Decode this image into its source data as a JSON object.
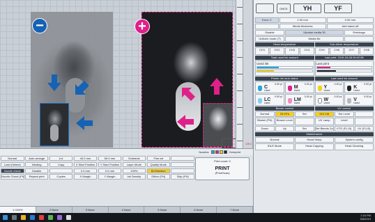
{
  "workarea": {
    "badge_minus": "−",
    "badge_plus": "+",
    "ruler_labels": [
      "",
      "",
      "",
      "",
      "",
      "",
      "",
      "",
      ""
    ],
    "red_tag": "125.0"
  },
  "toolbar_top": {
    "label_a": "Nozzles",
    "label_b": "Overprint"
  },
  "params": {
    "cells": [
      "Normal",
      "Auto arrange",
      "1x1",
      "40.0 mm",
      "50.0 mm",
      "Schedule",
      "Fine art",
      "",
      "Load (Select)",
      "Nesting",
      "Copy",
      "X Start Position",
      "Y Start Position",
      "Layer Mode",
      "Quality Mode",
      "",
      "Nozzle check",
      "Disable",
      "",
      "0.0 mm",
      "0.0 mm",
      "100%",
      "Bi-Direction",
      "",
      "Nozzle Check (FN)",
      "Repeat print",
      "Copies",
      "X Margin",
      "Y Margin",
      "Ink Density",
      "Dither (FN)",
      "Skip (FN)"
    ],
    "print_count_label": "Print count: 0",
    "print_label": "PRINT",
    "print_sub": "(Print/Scan)",
    "colors": {
      "accent": "#f3cf2a",
      "minus": "#1662b4",
      "plus": "#e0208a"
    }
  },
  "tabs": [
    "1 CMYK",
    "2 None",
    "3 None",
    "4 None",
    "5 None",
    "6 None",
    "7 None"
  ],
  "right_panel": {
    "header": {
      "badge_a": "YH",
      "badge_b": "YF",
      "small": "ONCE"
    },
    "row1": [
      "Error: 0",
      "2.00 mm",
      "0.00 mm"
    ],
    "row2": [
      "",
      "Media thickness",
      "Add stand-off"
    ],
    "row3": [
      "Disable",
      "Ukraine media 30",
      "Shrinkage"
    ],
    "row4": [
      "Uniform mode (T)",
      "Media file",
      ""
    ],
    "section_heads": {
      "head_temp": "Head temperature",
      "sub_temp": "Sub-driver temperature",
      "total_ink": "Total used ink amount",
      "last_print": "Last print: 2019-03-08 09:02:55",
      "tank": "Printer ink tank status",
      "last_ink": "Last used ink amount",
      "blower": "Blower control",
      "uv": "UV control",
      "maint": "Maintenance"
    },
    "head_cells": [
      "CH1",
      "CH2",
      "CH3",
      "CH4",
      "CH5",
      "CH6",
      "CH7",
      "CH8"
    ],
    "ink_summary": [
      "Used ink",
      "Last print"
    ],
    "inks": [
      {
        "letter": "C",
        "pct": "0.00 pl",
        "state": "Used",
        "color": "#22a7d8"
      },
      {
        "letter": "M",
        "pct": "0.00 pl",
        "state": "Used",
        "color": "#e0208a"
      },
      {
        "letter": "Y",
        "pct": "0.00 pl",
        "state": "Used",
        "color": "#f2d21e"
      },
      {
        "letter": "K",
        "pct": "0.00 pl",
        "state": "Used",
        "color": "#222222"
      },
      {
        "letter": "LC",
        "pct": "0.00 pl",
        "state": "Used",
        "color": "#7fd0ef"
      },
      {
        "letter": "LM",
        "pct": "0.00 pl",
        "state": "Used",
        "color": "#f08cc4"
      },
      {
        "letter": "W",
        "pct": "0.00 pl",
        "state": "Used",
        "color": "#ffffff"
      },
      {
        "letter": "V",
        "pct": "0.00 pl",
        "state": "Used",
        "color": "#b8b8b8"
      }
    ],
    "blower": [
      "Normal",
      "20 KPa",
      "Set",
      "Blower (FN)",
      "Blower Level",
      ""
    ],
    "uv": [
      "319 CM",
      "Set Level",
      "",
      "UV Lamp",
      "Level",
      ""
    ],
    "misc": [
      "Down",
      "Up",
      "Set",
      "Set Bleeds Zone",
      "KTG (FL15)",
      "UV (FL15)"
    ],
    "maint_cells": [
      "Normal",
      "Head Setup",
      "System config",
      "IDLE Mode",
      "Head Capping",
      "Head Cleaning"
    ]
  },
  "taskbar": {
    "time": "1:34 PM",
    "date": "3/8/2019"
  }
}
